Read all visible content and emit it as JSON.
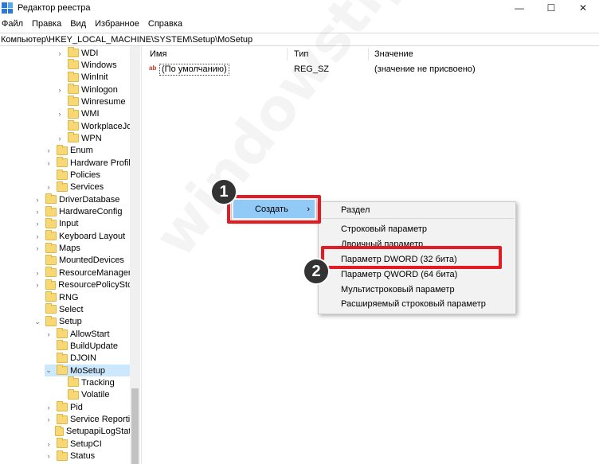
{
  "window": {
    "title": "Редактор реестра",
    "minimize": "—",
    "maximize": "☐",
    "close": "✕"
  },
  "menu": [
    "Файл",
    "Правка",
    "Вид",
    "Избранное",
    "Справка"
  ],
  "address": "Компьютер\\HKEY_LOCAL_MACHINE\\SYSTEM\\Setup\\MoSetup",
  "tree": [
    {
      "label": "WDI",
      "level": 2,
      "exp": "›"
    },
    {
      "label": "Windows",
      "level": 2,
      "exp": ""
    },
    {
      "label": "WinInit",
      "level": 2,
      "exp": ""
    },
    {
      "label": "Winlogon",
      "level": 2,
      "exp": "›"
    },
    {
      "label": "Winresume",
      "level": 2,
      "exp": ""
    },
    {
      "label": "WMI",
      "level": 2,
      "exp": "›"
    },
    {
      "label": "WorkplaceJoin",
      "level": 2,
      "exp": ""
    },
    {
      "label": "WPN",
      "level": 2,
      "exp": "›"
    },
    {
      "label": "Enum",
      "level": 1,
      "exp": "›"
    },
    {
      "label": "Hardware Profiles",
      "level": 1,
      "exp": "›"
    },
    {
      "label": "Policies",
      "level": 1,
      "exp": ""
    },
    {
      "label": "Services",
      "level": 1,
      "exp": "›"
    },
    {
      "label": "DriverDatabase",
      "level": 0,
      "exp": "›"
    },
    {
      "label": "HardwareConfig",
      "level": 0,
      "exp": "›"
    },
    {
      "label": "Input",
      "level": 0,
      "exp": "›"
    },
    {
      "label": "Keyboard Layout",
      "level": 0,
      "exp": "›"
    },
    {
      "label": "Maps",
      "level": 0,
      "exp": "›"
    },
    {
      "label": "MountedDevices",
      "level": 0,
      "exp": ""
    },
    {
      "label": "ResourceManager",
      "level": 0,
      "exp": "›"
    },
    {
      "label": "ResourcePolicyStore",
      "level": 0,
      "exp": "›"
    },
    {
      "label": "RNG",
      "level": 0,
      "exp": ""
    },
    {
      "label": "Select",
      "level": 0,
      "exp": ""
    },
    {
      "label": "Setup",
      "level": 0,
      "exp": "⌄"
    },
    {
      "label": "AllowStart",
      "level": 1,
      "exp": "›"
    },
    {
      "label": "BuildUpdate",
      "level": 1,
      "exp": ""
    },
    {
      "label": "DJOIN",
      "level": 1,
      "exp": ""
    },
    {
      "label": "MoSetup",
      "level": 1,
      "exp": "⌄",
      "selected": true
    },
    {
      "label": "Tracking",
      "level": 2,
      "exp": ""
    },
    {
      "label": "Volatile",
      "level": 2,
      "exp": ""
    },
    {
      "label": "Pid",
      "level": 1,
      "exp": "›"
    },
    {
      "label": "Service Reporting",
      "level": 1,
      "exp": "›"
    },
    {
      "label": "SetupapiLogStatus",
      "level": 1,
      "exp": ""
    },
    {
      "label": "SetupCI",
      "level": 1,
      "exp": "›"
    },
    {
      "label": "Status",
      "level": 1,
      "exp": "›"
    }
  ],
  "list": {
    "headers": {
      "name": "Имя",
      "type": "Тип",
      "value": "Значение"
    },
    "rows": [
      {
        "icon": "ab",
        "name": "(По умолчанию)",
        "type": "REG_SZ",
        "value": "(значение не присвоено)"
      }
    ]
  },
  "context_menu": {
    "create_label": "Создать",
    "arrow": "›",
    "submenu": [
      "Раздел",
      "Строковый параметр",
      "Двоичный параметр",
      "Параметр DWORD (32 бита)",
      "Параметр QWORD (64 бита)",
      "Мультистроковый параметр",
      "Расширяемый строковый параметр"
    ]
  },
  "annotations": {
    "step1": "1",
    "step2": "2",
    "highlight_color": "#e31b23"
  },
  "watermark": "windowstips.ru"
}
